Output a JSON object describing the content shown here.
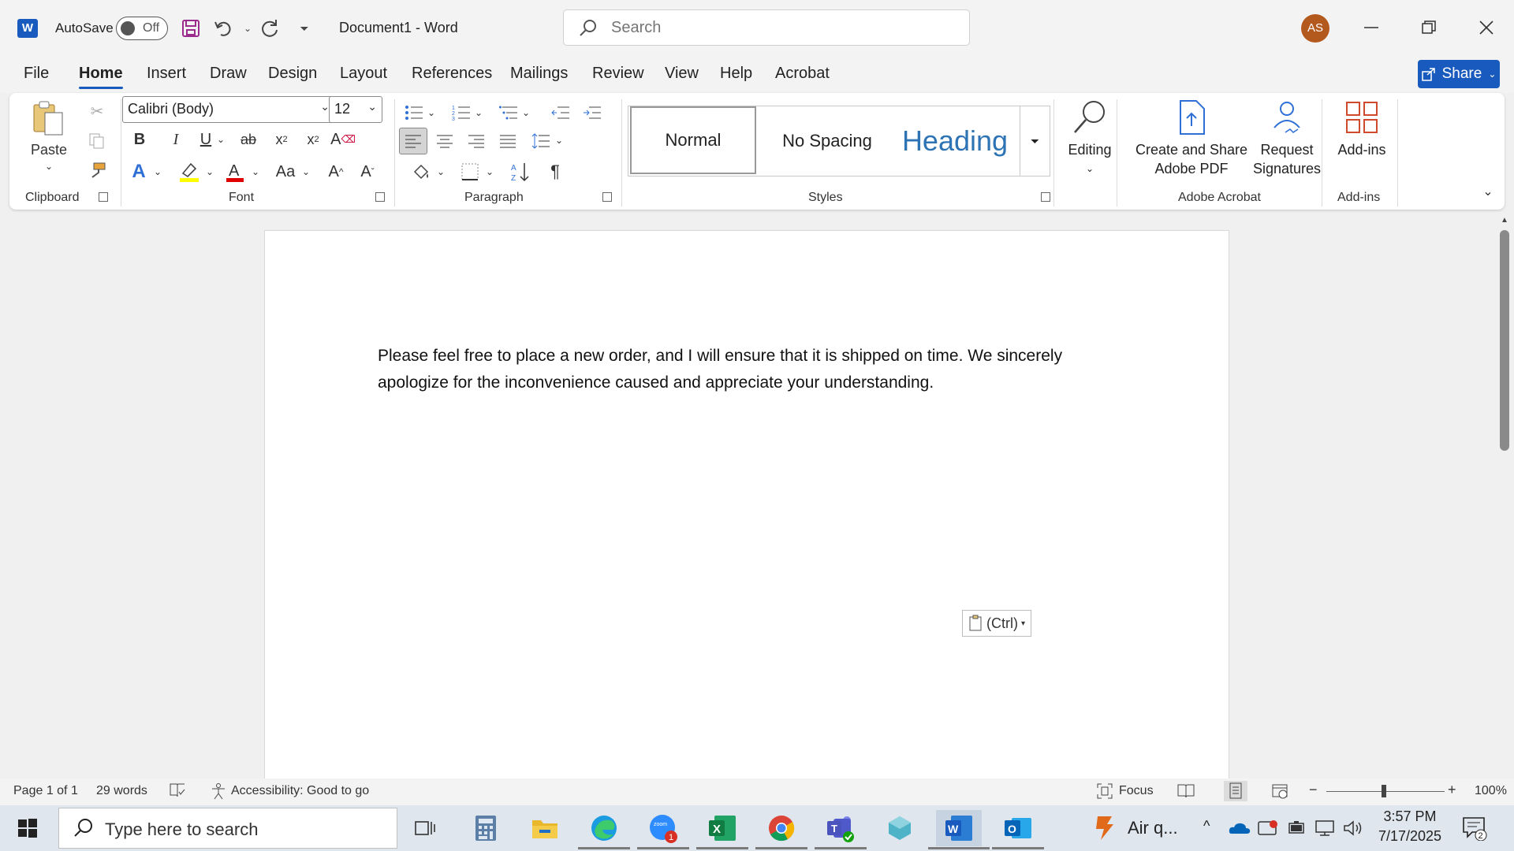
{
  "titlebar": {
    "autosave_label": "AutoSave",
    "autosave_state": "Off",
    "doc_title": "Document1  -  Word",
    "search_placeholder": "Search",
    "avatar_initials": "AS"
  },
  "tabs": [
    "File",
    "Home",
    "Insert",
    "Draw",
    "Design",
    "Layout",
    "References",
    "Mailings",
    "Review",
    "View",
    "Help",
    "Acrobat"
  ],
  "share_label": "Share",
  "ribbon": {
    "clipboard": {
      "paste_label": "Paste",
      "group_label": "Clipboard"
    },
    "font": {
      "font_name": "Calibri (Body)",
      "font_size": "12",
      "group_label": "Font",
      "change_case": "Aa"
    },
    "paragraph": {
      "group_label": "Paragraph"
    },
    "styles": {
      "items": [
        "Normal",
        "No Spacing",
        "Heading"
      ],
      "group_label": "Styles"
    },
    "editing_label": "Editing",
    "acrobat": {
      "create_line1": "Create and Share",
      "create_line2": "Adobe PDF",
      "request_line1": "Request",
      "request_line2": "Signatures",
      "group_label": "Adobe Acrobat"
    },
    "addins": {
      "label": "Add-ins",
      "group_label": "Add-ins"
    }
  },
  "document": {
    "text": "Please feel free to place a new order, and I will ensure that it is shipped on time. We sincerely apologize for the inconvenience caused and appreciate your understanding.",
    "paste_options": "(Ctrl)"
  },
  "statusbar": {
    "page": "Page 1 of 1",
    "words": "29 words",
    "accessibility": "Accessibility: Good to go",
    "focus": "Focus",
    "zoom": "100%"
  },
  "taskbar": {
    "search_placeholder": "Type here to search",
    "weather": "Air q...",
    "time": "3:57 PM",
    "date": "7/17/2025",
    "notification_count": "2",
    "zoom_badge": "1"
  },
  "colors": {
    "accent": "#185abd",
    "highlight": "#ffff00",
    "font_color": "#e00000"
  }
}
